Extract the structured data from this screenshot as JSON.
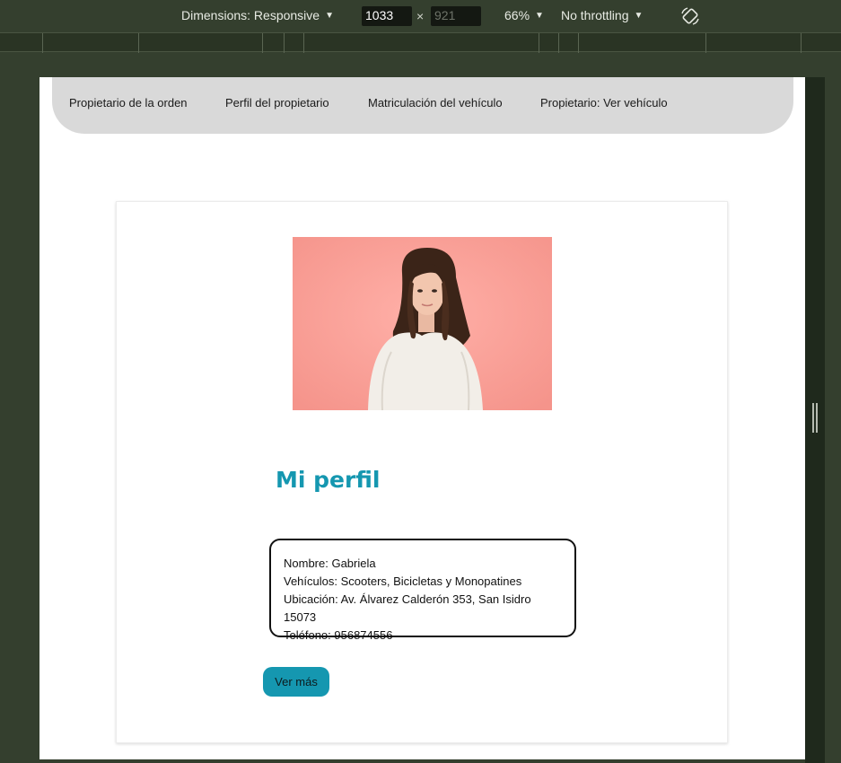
{
  "devtools": {
    "dimensions_label": "Dimensions: Responsive",
    "width_value": "1033",
    "height_value": "921",
    "times": "×",
    "zoom_label": "66%",
    "throttling_label": "No throttling",
    "rotate_icon": "rotate-icon"
  },
  "nav": {
    "items": [
      {
        "label": "Propietario de la orden"
      },
      {
        "label": "Perfil del propietario"
      },
      {
        "label": "Matriculación del vehículo"
      },
      {
        "label": "Propietario: Ver vehículo"
      }
    ]
  },
  "profile": {
    "title": "Mi perfil",
    "name": "Nombre: Gabriela",
    "vehicles": "Vehículos: Scooters, Bicicletas y Monopatines",
    "location": "Ubicación: Av. Álvarez Calderón 353, San Isidro 15073",
    "phone": "Teléfono: 956874556",
    "button_label": "Ver más",
    "photo_bg": "#f7a39a",
    "accent": "#1597b0"
  }
}
